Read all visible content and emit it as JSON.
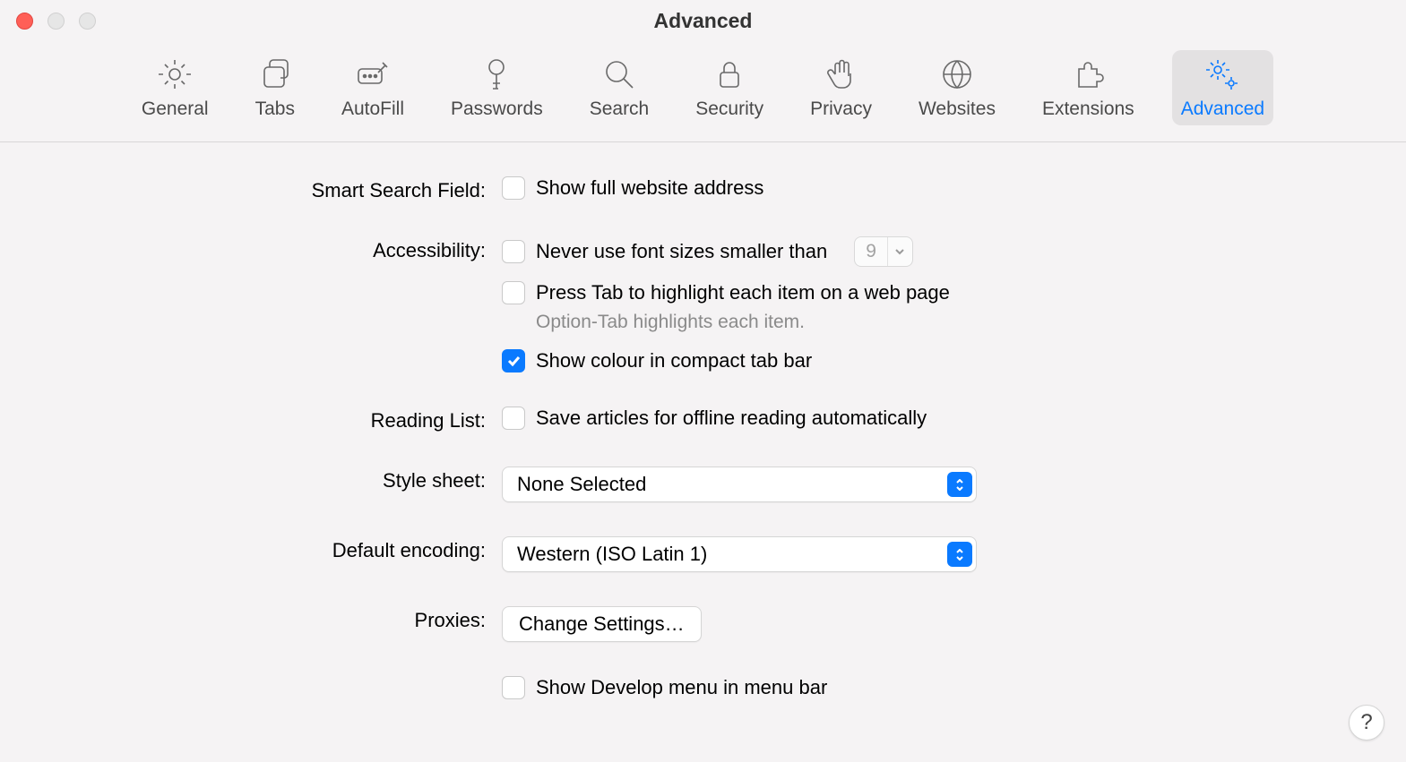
{
  "window_title": "Advanced",
  "toolbar": {
    "items": [
      {
        "label": "General"
      },
      {
        "label": "Tabs"
      },
      {
        "label": "AutoFill"
      },
      {
        "label": "Passwords"
      },
      {
        "label": "Search"
      },
      {
        "label": "Security"
      },
      {
        "label": "Privacy"
      },
      {
        "label": "Websites"
      },
      {
        "label": "Extensions"
      },
      {
        "label": "Advanced"
      }
    ],
    "active": "Advanced"
  },
  "sections": {
    "smartSearch": {
      "label": "Smart Search Field:",
      "opt_showFullAddress": "Show full website address"
    },
    "accessibility": {
      "label": "Accessibility:",
      "opt_neverSmallerThan": "Never use font sizes smaller than",
      "fontSizeValue": "9",
      "opt_tabHighlight": "Press Tab to highlight each item on a web page",
      "hint_optionTab": "Option-Tab highlights each item.",
      "opt_showColour": "Show colour in compact tab bar"
    },
    "readingList": {
      "label": "Reading List:",
      "opt_saveOffline": "Save articles for offline reading automatically"
    },
    "styleSheet": {
      "label": "Style sheet:",
      "value": "None Selected"
    },
    "defaultEncoding": {
      "label": "Default encoding:",
      "value": "Western (ISO Latin 1)"
    },
    "proxies": {
      "label": "Proxies:",
      "button": "Change Settings…"
    },
    "develop": {
      "opt_showDevelop": "Show Develop menu in menu bar"
    }
  },
  "help_symbol": "?"
}
